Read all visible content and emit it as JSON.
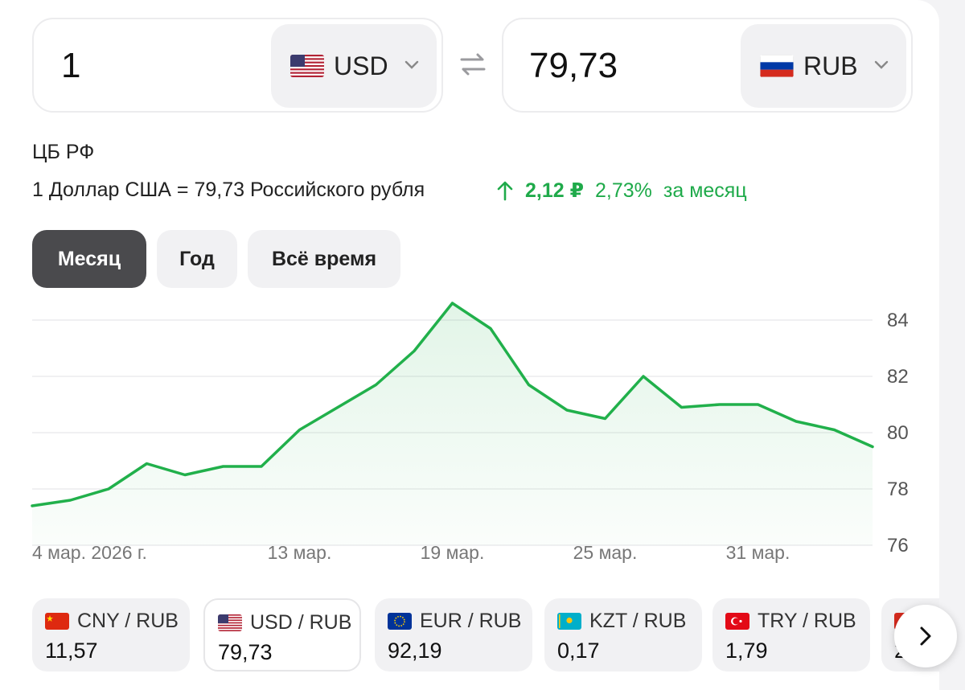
{
  "converter": {
    "from": {
      "amount": "1",
      "code": "USD",
      "flag_icon": "us-flag-icon"
    },
    "to": {
      "amount": "79,73",
      "code": "RUB",
      "flag_icon": "ru-flag-icon"
    }
  },
  "source": "ЦБ РФ",
  "rate_text": "1 Доллар США = 79,73 Российского рубля",
  "change": {
    "abs": "2,12 ₽",
    "pct": "2,73%",
    "period": "за месяц",
    "color": "#1faa4a"
  },
  "periods": [
    {
      "label": "Месяц",
      "active": true
    },
    {
      "label": "Год",
      "active": false
    },
    {
      "label": "Всё время",
      "active": false
    }
  ],
  "chart_data": {
    "type": "area",
    "series": [
      {
        "values": [
          77.4,
          77.6,
          78.0,
          78.9,
          78.5,
          78.8,
          78.8,
          80.1,
          80.9,
          81.7,
          82.9,
          84.6,
          83.7,
          81.7,
          80.8,
          80.5,
          82.0,
          80.9,
          81.0,
          81.0,
          80.4,
          80.1,
          79.5
        ]
      }
    ],
    "ylim": [
      76,
      84.8
    ],
    "yticks": [
      "84",
      "82",
      "80",
      "78",
      "76"
    ],
    "xticks": [
      "4 мар. 2026 г.",
      "13 мар.",
      "19 мар.",
      "25 мар.",
      "31 мар."
    ],
    "line_color": "#21b04b",
    "grid": true
  },
  "pairs": [
    {
      "name": "CNY / RUB",
      "value": "11,57",
      "flag_icon": "cn-flag-icon",
      "selected": false
    },
    {
      "name": "USD / RUB",
      "value": "79,73",
      "flag_icon": "us-flag-icon",
      "selected": true
    },
    {
      "name": "EUR / RUB",
      "value": "92,19",
      "flag_icon": "eu-flag-icon",
      "selected": false
    },
    {
      "name": "KZT / RUB",
      "value": "0,17",
      "flag_icon": "kz-flag-icon",
      "selected": false
    },
    {
      "name": "TRY / RUB",
      "value": "1,79",
      "flag_icon": "tr-flag-icon",
      "selected": false
    }
  ],
  "partial_pair_value": "2",
  "next_icon": "chevron-right-icon"
}
